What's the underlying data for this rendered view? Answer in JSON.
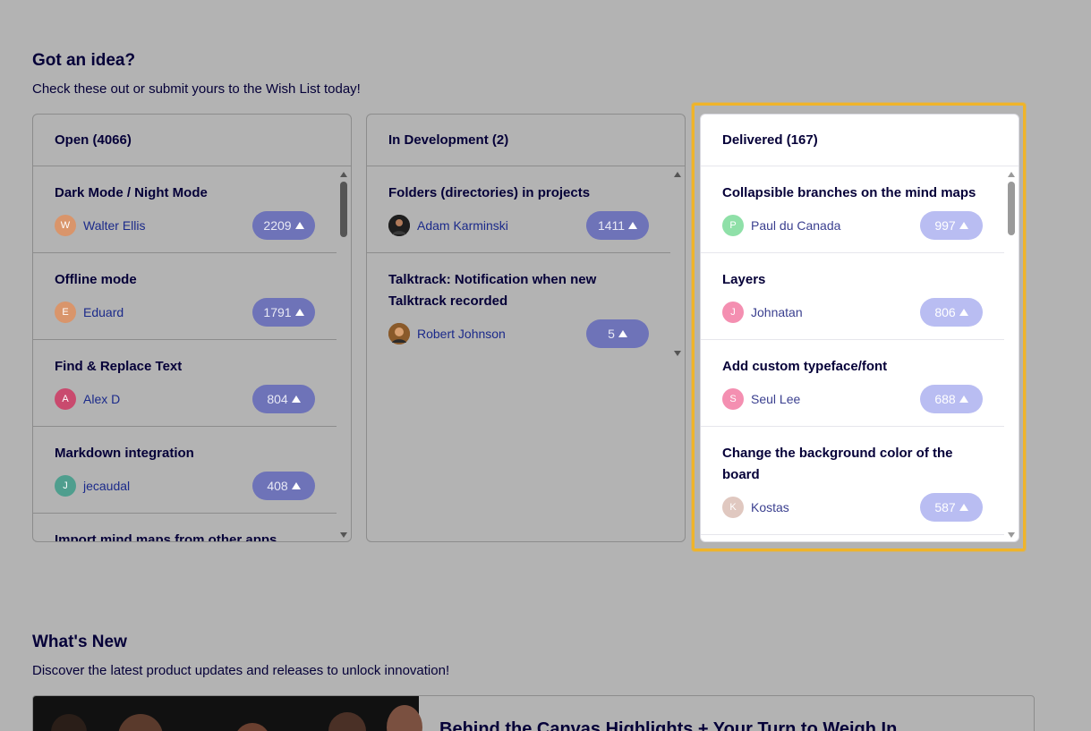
{
  "wishlist": {
    "title": "Got an idea?",
    "subtitle": "Check these out or submit yours to the Wish List today!",
    "columns": [
      {
        "header": "Open (4066)",
        "items": [
          {
            "title": "Dark Mode / Night Mode",
            "author": "Walter Ellis",
            "initial": "W",
            "votes": "2209",
            "avatar_color": "#d9956b"
          },
          {
            "title": "Offline mode",
            "author": "Eduard",
            "initial": "E",
            "votes": "1791",
            "avatar_color": "#d9956b"
          },
          {
            "title": "Find & Replace Text",
            "author": "Alex D",
            "initial": "A",
            "votes": "804",
            "avatar_color": "#c94a6e"
          },
          {
            "title": "Markdown integration",
            "author": "jecaudal",
            "initial": "J",
            "votes": "408",
            "avatar_color": "#4f9e8e"
          },
          {
            "title": "Import mind maps from other apps",
            "author": "",
            "initial": "",
            "votes": "",
            "avatar_color": ""
          }
        ]
      },
      {
        "header": "In Development (2)",
        "items": [
          {
            "title": "Folders (directories) in projects",
            "author": "Adam Karminski",
            "initial": "",
            "votes": "1411",
            "avatar_color": "#2b2b2b"
          },
          {
            "title": "Talktrack: Notification when new Talktrack recorded",
            "author": "Robert Johnson",
            "initial": "",
            "votes": "5",
            "avatar_color": "#7a4a20"
          }
        ]
      },
      {
        "header": "Delivered (167)",
        "items": [
          {
            "title": "Collapsible branches on the mind maps",
            "author": "Paul du Canada",
            "initial": "P",
            "votes": "997",
            "avatar_color": "#8fe0a8"
          },
          {
            "title": "Layers",
            "author": "Johnatan",
            "initial": "J",
            "votes": "806",
            "avatar_color": "#f48fb1"
          },
          {
            "title": "Add custom typeface/font",
            "author": "Seul Lee",
            "initial": "S",
            "votes": "688",
            "avatar_color": "#f48fb1"
          },
          {
            "title": "Change the background color of the board",
            "author": "Kostas",
            "initial": "K",
            "votes": "587",
            "avatar_color": "#e0c8c0"
          }
        ]
      }
    ]
  },
  "whats_new": {
    "title": "What's New",
    "subtitle": "Discover the latest product updates and releases to unlock innovation!",
    "card_title": "Behind the Canvas Highlights + Your Turn to Weigh In"
  },
  "colors": {
    "highlight": "#f0b429",
    "vote_dim": "#6e73b8",
    "vote_light": "#b9bdf2"
  }
}
